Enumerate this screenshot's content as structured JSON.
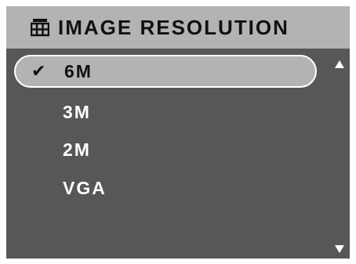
{
  "header": {
    "title": "IMAGE RESOLUTION",
    "icon": "grid-icon"
  },
  "menu": {
    "items": [
      {
        "label": "6M",
        "selected": true,
        "check": "✔"
      },
      {
        "label": "3M",
        "selected": false,
        "check": ""
      },
      {
        "label": "2M",
        "selected": false,
        "check": ""
      },
      {
        "label": "VGA",
        "selected": false,
        "check": ""
      }
    ]
  },
  "scroll": {
    "up_icon": "triangle-up-icon",
    "down_icon": "triangle-down-icon"
  },
  "colors": {
    "background": "#575757",
    "header": "#b3b3b3",
    "text": "#ffffff",
    "highlight_border": "#ffffff"
  }
}
